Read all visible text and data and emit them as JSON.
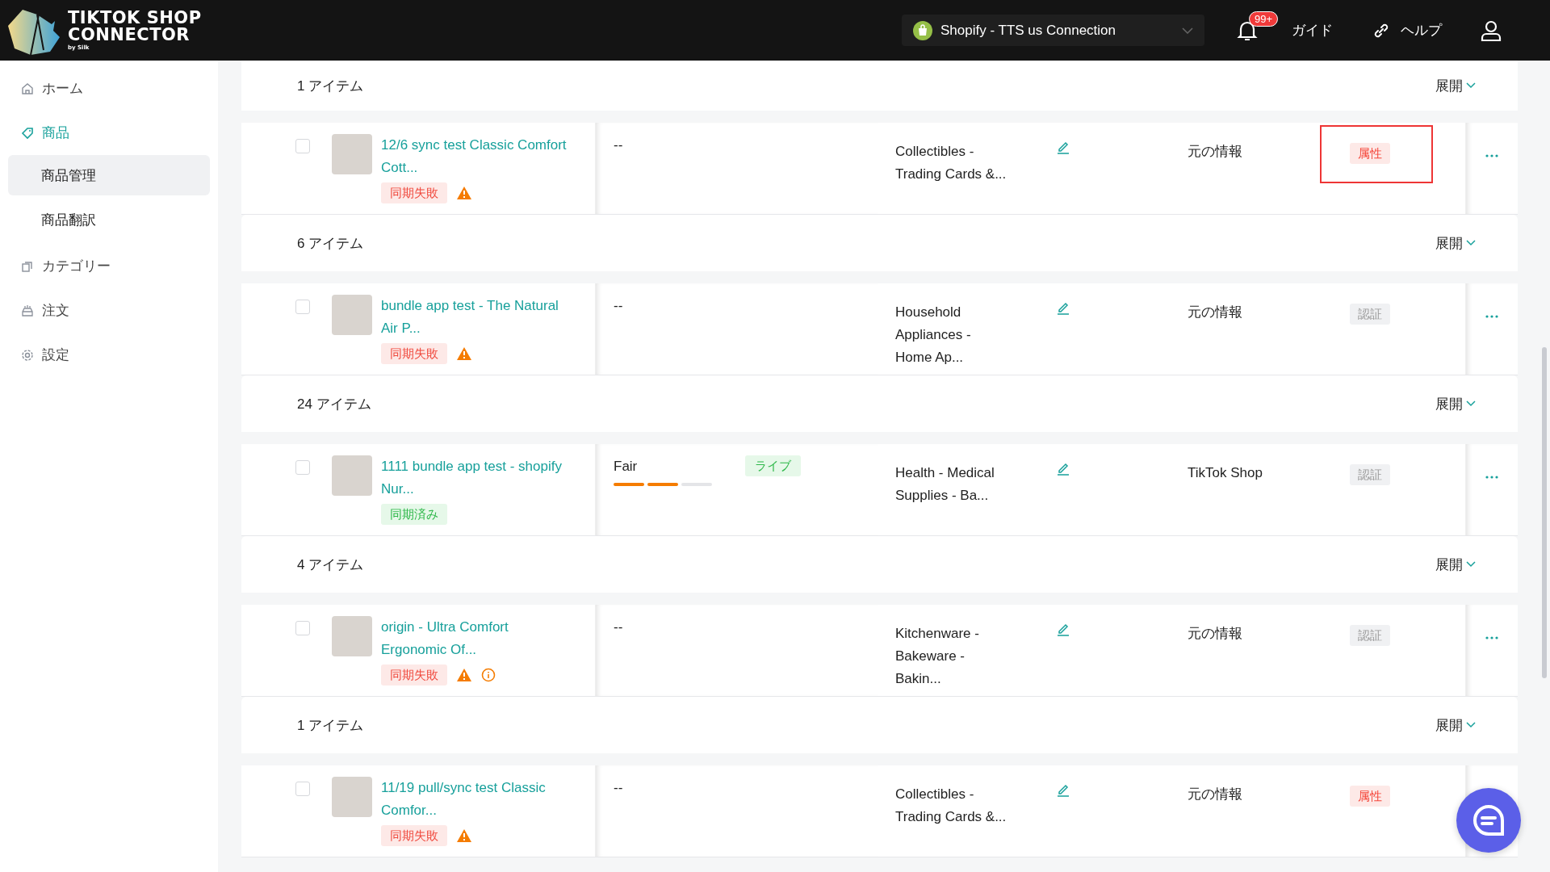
{
  "topbar": {
    "logo": {
      "title_line_1": "TIKTOK SHOP",
      "title_line_2": "CONNECTOR",
      "byline": "by Silk"
    },
    "store_selector": {
      "value": "Shopify - TTS us Connection"
    },
    "notification_badge": "99+",
    "guide": "ガイド",
    "help": "ヘルプ"
  },
  "sidebar": {
    "items": [
      {
        "label": "ホーム",
        "selected": false
      },
      {
        "label": "商品",
        "selected": true,
        "expanded": true,
        "children": [
          {
            "label": "商品管理",
            "selected": true
          },
          {
            "label": "商品翻訳",
            "selected": false
          }
        ]
      },
      {
        "label": "カテゴリー",
        "selected": false
      },
      {
        "label": "注文",
        "selected": false
      },
      {
        "label": "設定",
        "selected": false
      }
    ]
  },
  "groups": [
    {
      "count": "1 アイテム",
      "expand": "展開",
      "product": {
        "checked": false,
        "title": "12/6 sync test Classic Comfort Cott...",
        "sync": {
          "kind": "failed",
          "label": "同期失敗"
        },
        "warning": true,
        "info": false,
        "listing": {
          "kind": "none",
          "text": "--"
        },
        "category": "Collectibles - Trading Cards &...",
        "source": "元の情報",
        "tag": {
          "kind": "attribute",
          "label": "属性"
        },
        "highlighted": true
      }
    },
    {
      "count": "6 アイテム",
      "expand": "展開",
      "product": {
        "checked": false,
        "title": "bundle app test - The Natural Air P...",
        "sync": {
          "kind": "failed",
          "label": "同期失敗"
        },
        "warning": true,
        "info": false,
        "listing": {
          "kind": "none",
          "text": "--"
        },
        "category": "Household Appliances - Home Ap...",
        "source": "元の情報",
        "tag": {
          "kind": "certification",
          "label": "認証"
        },
        "highlighted": false
      }
    },
    {
      "count": "24 アイテム",
      "expand": "展開",
      "product": {
        "checked": false,
        "title": "1111 bundle app test - shopify Nur...",
        "sync": {
          "kind": "synced",
          "label": "同期済み"
        },
        "warning": false,
        "info": false,
        "listing": {
          "kind": "quality",
          "label": "Fair",
          "level": 0.67,
          "status": "ライブ"
        },
        "category": "Health - Medical Supplies - Ba...",
        "source": "TikTok Shop",
        "tag": {
          "kind": "certification",
          "label": "認証"
        },
        "highlighted": false
      }
    },
    {
      "count": "4 アイテム",
      "expand": "展開",
      "product": {
        "checked": false,
        "title": "origin - Ultra Comfort Ergonomic Of...",
        "sync": {
          "kind": "failed",
          "label": "同期失敗"
        },
        "warning": true,
        "info": true,
        "listing": {
          "kind": "none",
          "text": "--"
        },
        "category": "Kitchenware - Bakeware - Bakin...",
        "source": "元の情報",
        "tag": {
          "kind": "certification",
          "label": "認証"
        },
        "highlighted": false
      }
    },
    {
      "count": "1 アイテム",
      "expand": "展開",
      "product": {
        "checked": false,
        "title": "11/19 pull/sync test Classic Comfor...",
        "sync": {
          "kind": "failed",
          "label": "同期失敗"
        },
        "warning": true,
        "info": false,
        "listing": {
          "kind": "none",
          "text": "--"
        },
        "category": "Collectibles - Trading Cards &...",
        "source": "元の情報",
        "tag": {
          "kind": "attribute",
          "label": "属性"
        },
        "highlighted": false
      }
    }
  ]
}
